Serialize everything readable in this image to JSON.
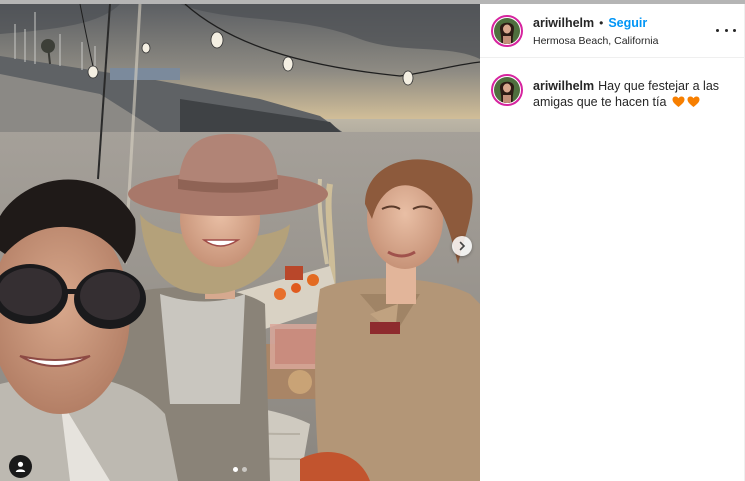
{
  "post": {
    "username": "ariwilhelm",
    "separator": "•",
    "follow_label": "Seguir",
    "location": "Hermosa Beach, California",
    "caption_text": "Hay que festejar a las amigas que te hacen tía",
    "caption_emojis": [
      "orange-heart",
      "orange-heart"
    ]
  },
  "media": {
    "slide_count": 2,
    "active_slide": 1
  },
  "colors": {
    "follow": "#0095f6",
    "text": "#262626",
    "avatar_ring": "#d6249f",
    "heart": "#f77f00"
  },
  "icons": [
    "more-options-icon",
    "chevron-right-icon",
    "user-tag-icon"
  ]
}
